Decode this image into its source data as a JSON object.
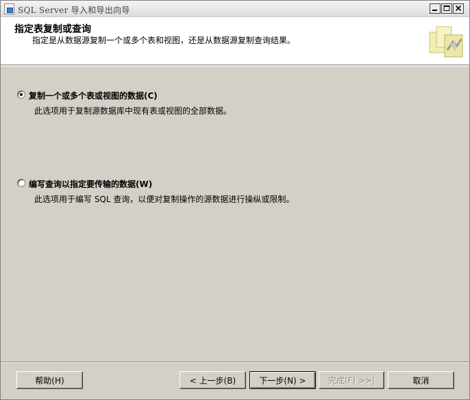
{
  "window": {
    "title": "SQL Server 导入和导出向导",
    "controls": {
      "minimize": "minimize",
      "maximize": "maximize",
      "close": "close"
    }
  },
  "header": {
    "title": "指定表复制或查询",
    "subtitle": "指定是从数据源复制一个或多个表和视图，还是从数据源复制查询结果。"
  },
  "options": [
    {
      "label": "复制一个或多个表或视图的数据(C)",
      "description": "此选项用于复制源数据库中现有表或视图的全部数据。",
      "checked": true
    },
    {
      "label": "编写查询以指定要传输的数据(W)",
      "description": "此选项用于编写 SQL 查询，以便对复制操作的源数据进行操纵或限制。",
      "checked": false
    }
  ],
  "buttons": {
    "help": "帮助(H)",
    "back": "< 上一步(B)",
    "next": "下一步(N) >",
    "finish": "完成(F) >>|",
    "cancel": "取消"
  }
}
